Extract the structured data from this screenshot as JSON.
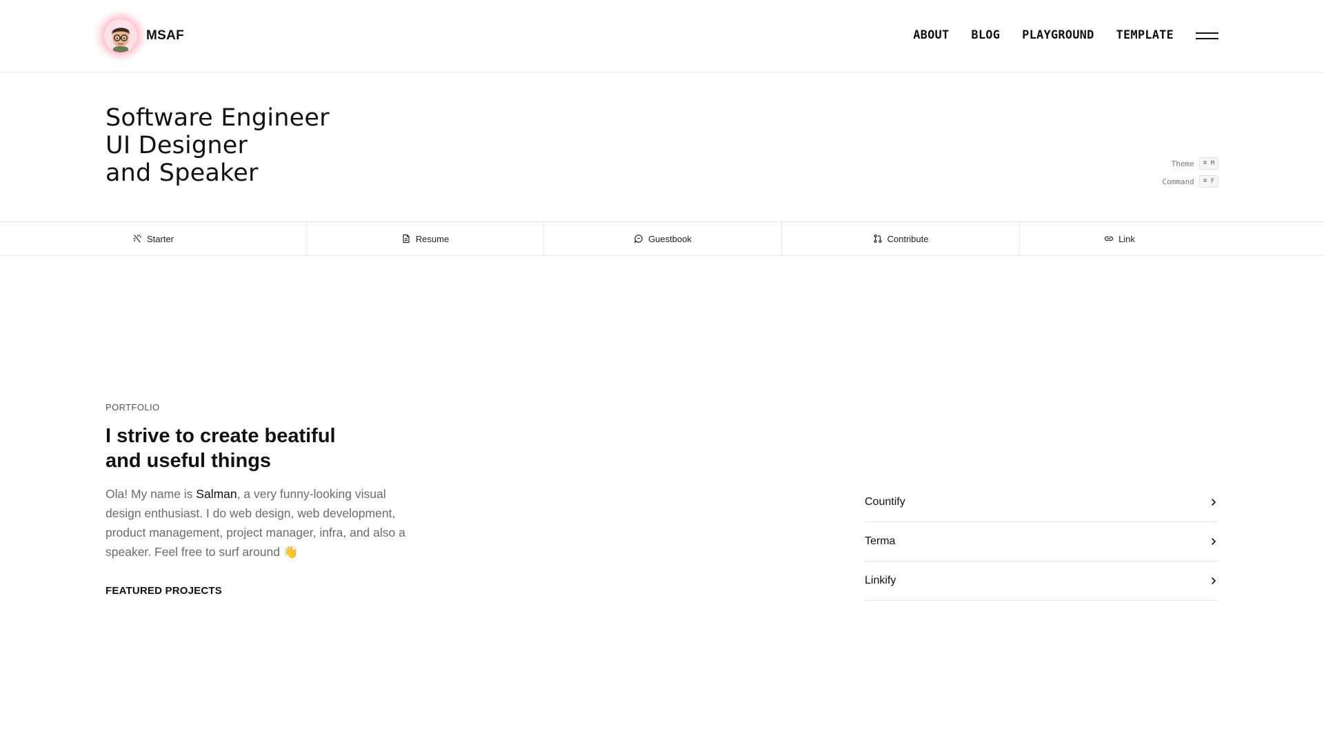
{
  "brand": {
    "name": "MSAF"
  },
  "nav": {
    "items": [
      {
        "label": "ABOUT"
      },
      {
        "label": "BLOG"
      },
      {
        "label": "PLAYGROUND"
      },
      {
        "label": "TEMPLATE"
      }
    ]
  },
  "hero": {
    "lines": [
      "Software Engineer",
      "UI Designer",
      "and Speaker"
    ],
    "shortcuts": [
      {
        "label": "Theme",
        "key": "⌘ M"
      },
      {
        "label": "Command",
        "key": "⌘ F"
      }
    ]
  },
  "tabs": [
    {
      "label": "Starter",
      "icon": "sparkles-icon"
    },
    {
      "label": "Resume",
      "icon": "file-icon"
    },
    {
      "label": "Guestbook",
      "icon": "chat-icon"
    },
    {
      "label": "Contribute",
      "icon": "git-pull-request-icon"
    },
    {
      "label": "Link",
      "icon": "link-icon"
    }
  ],
  "portfolio": {
    "eyebrow": "PORTFOLIO",
    "title_lines": [
      "I strive to create beatiful",
      "and useful things"
    ],
    "intro_before": "Ola! My name is ",
    "intro_name": "Salman",
    "intro_after": ", a very funny-looking visual design enthusiast. I do web design, web development, product management, project manager, infra, and also a speaker. Feel free to surf around 👋",
    "featured_label": "FEATURED PROJECTS",
    "projects": [
      {
        "name": "Countify"
      },
      {
        "name": "Terma"
      },
      {
        "name": "Linkify"
      }
    ]
  },
  "colors": {
    "text": "#111111",
    "muted": "#6b6b6b",
    "border": "#e6e6e6",
    "avatar_glow": "#ff466e"
  }
}
